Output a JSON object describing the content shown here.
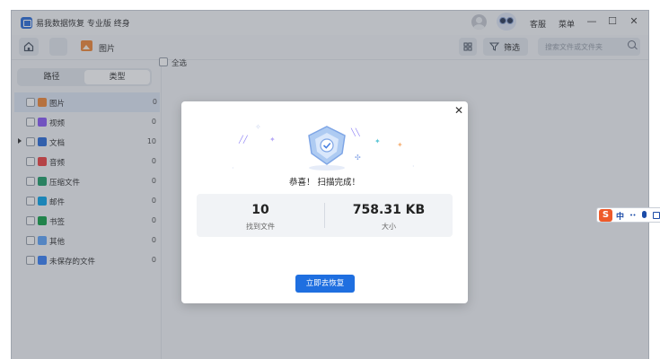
{
  "app": {
    "title": "易我数据恢复 专业版 终身"
  },
  "titlebar": {
    "service_label": "客服",
    "menu_label": "菜单",
    "minimize_glyph": "—",
    "maximize_glyph": "☐",
    "close_glyph": "✕"
  },
  "toolbar": {
    "breadcrumb": "图片",
    "filter_label": "筛选",
    "search_placeholder": "搜索文件或文件夹"
  },
  "sidebar": {
    "tabs": [
      {
        "label": "路径",
        "active": false
      },
      {
        "label": "类型",
        "active": true
      }
    ],
    "items": [
      {
        "label": "图片",
        "count": "0",
        "icon": "image-icon",
        "color": "#f08a3a",
        "selected": true
      },
      {
        "label": "视频",
        "count": "0",
        "icon": "video-icon",
        "color": "#8b5cf6"
      },
      {
        "label": "文档",
        "count": "10",
        "icon": "document-icon",
        "color": "#2f6fd9",
        "expandable": true
      },
      {
        "label": "音频",
        "count": "0",
        "icon": "audio-icon",
        "color": "#ef4444"
      },
      {
        "label": "压缩文件",
        "count": "0",
        "icon": "archive-icon",
        "color": "#22a06b"
      },
      {
        "label": "邮件",
        "count": "0",
        "icon": "mail-icon",
        "color": "#0ea5e9"
      },
      {
        "label": "书签",
        "count": "0",
        "icon": "bookmark-icon",
        "color": "#16a34a"
      },
      {
        "label": "其他",
        "count": "0",
        "icon": "folder-icon",
        "color": "#60a5fa"
      },
      {
        "label": "未保存的文件",
        "count": "0",
        "icon": "unsaved-file-icon",
        "color": "#3b82f6"
      }
    ]
  },
  "content": {
    "select_all_label": "全选"
  },
  "dialog": {
    "congrats": "恭喜！ 扫描完成！",
    "found_value": "10",
    "found_label": "找到文件",
    "size_value": "758.31 KB",
    "size_label": "大小",
    "recover_button": "立即去恢复",
    "close_glyph": "✕"
  },
  "ime": {
    "logo": "S",
    "mode": "中"
  },
  "colors": {
    "accent": "#1f6fe0",
    "overlay": "rgba(60,66,78,0.32)"
  }
}
